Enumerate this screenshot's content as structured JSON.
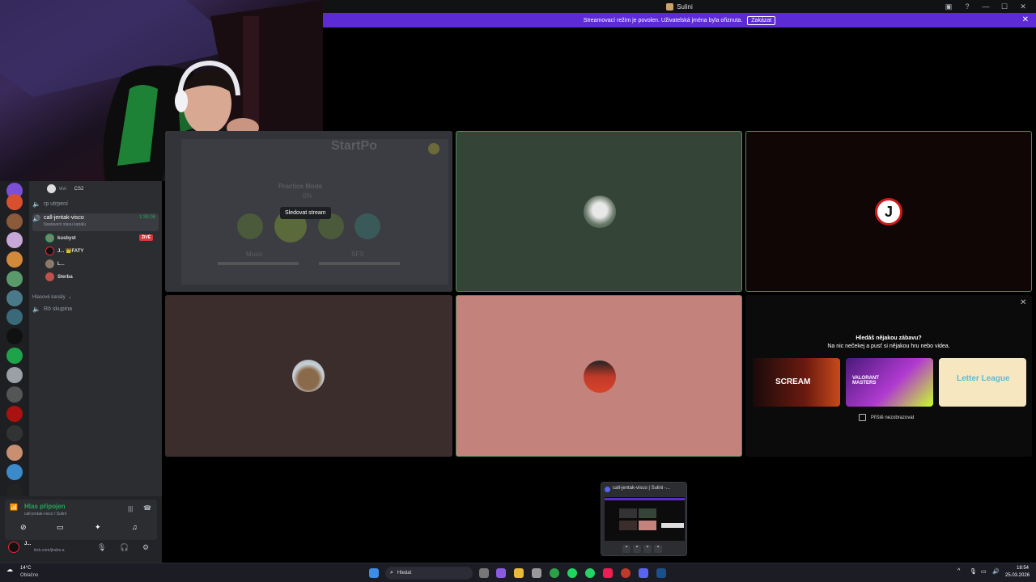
{
  "window": {
    "title": "Sulini"
  },
  "banner": {
    "text": "Streamovací režim je povolen. Uživatelská jména byla ořiznuta.",
    "disable_label": "Zakázat"
  },
  "channels": {
    "member_top": "vivi",
    "member_top_game": "CS2",
    "rp_channel": "rp utrpení",
    "call_channel": "call-jentak-visco",
    "call_timer": "1:39:06",
    "call_status_prompt": "Nastavení stavu kanálu",
    "members": [
      {
        "name": "kusbyst",
        "badge": "ŽIVĚ"
      },
      {
        "name": "J... 👑FATY"
      },
      {
        "name": "L..."
      },
      {
        "name": "Sterba"
      }
    ],
    "voice_section_label": "Hlasové kanály",
    "group_channel": "Ró skupina"
  },
  "stage": {
    "stream_hover_label": "Sledovat stream",
    "game_texts": {
      "title": "StartPo",
      "practice": "Practice Mode",
      "percent": "0%",
      "music": "Music",
      "sfx": "SFX",
      "counter": "1/1"
    },
    "activities": {
      "headline": "Hledáš nějakou zábavu?",
      "subline": "Na nic nečekej a pusť si nějakou hru nebo videa.",
      "games": [
        "SCREAM",
        "VALORANT MASTERS",
        "Letter League"
      ],
      "dont_show_label": "Příště nezobrazovat"
    }
  },
  "voice_panel": {
    "status": "Hlas připojen",
    "location": "call-jentak-visco / Sulini",
    "user_name": "J...",
    "user_status": "kick.com/jindra-a"
  },
  "thumbnail": {
    "title": "call-jentak-visco | Sulini -..."
  },
  "taskbar": {
    "weather_temp": "14°C",
    "weather_desc": "Oblačno",
    "search_placeholder": "Hledat",
    "time": "18:54",
    "date": "25.03.2026"
  },
  "colors": {
    "accent": "#5d2bd6",
    "live": "#da373c",
    "voice_green": "#23a55a",
    "speaking_border": "#4f8a56"
  }
}
